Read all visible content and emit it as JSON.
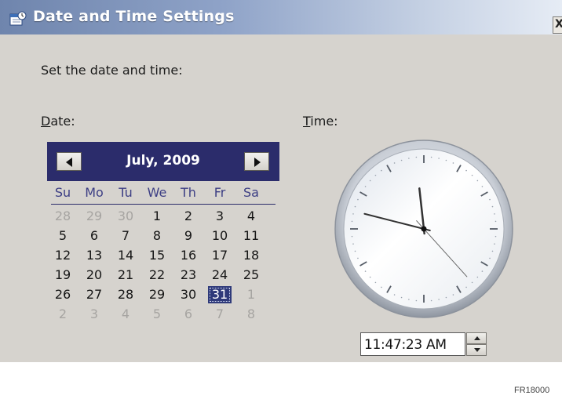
{
  "window": {
    "title": "Date and Time Settings",
    "title_icon": "calendar-clock-icon",
    "close_label": "X",
    "colors": {
      "titlebar_start": "#6f85ad",
      "titlebar_end": "#e6ecf5",
      "body": "#d6d3ce"
    }
  },
  "instruction": "Set the date and time:",
  "date_label": "Date:",
  "time_label": "Time:",
  "calendar": {
    "month_title": "July, 2009",
    "prev_icon": "left-arrow-icon",
    "next_icon": "right-arrow-icon",
    "header_color": "#2b2c6b",
    "days_of_week": [
      "Su",
      "Mo",
      "Tu",
      "We",
      "Th",
      "Fr",
      "Sa"
    ],
    "weeks": [
      [
        {
          "d": "28",
          "o": true
        },
        {
          "d": "29",
          "o": true
        },
        {
          "d": "30",
          "o": true
        },
        {
          "d": "1"
        },
        {
          "d": "2"
        },
        {
          "d": "3"
        },
        {
          "d": "4"
        }
      ],
      [
        {
          "d": "5"
        },
        {
          "d": "6"
        },
        {
          "d": "7"
        },
        {
          "d": "8"
        },
        {
          "d": "9"
        },
        {
          "d": "10"
        },
        {
          "d": "11"
        }
      ],
      [
        {
          "d": "12"
        },
        {
          "d": "13"
        },
        {
          "d": "14"
        },
        {
          "d": "15"
        },
        {
          "d": "16"
        },
        {
          "d": "17"
        },
        {
          "d": "18"
        }
      ],
      [
        {
          "d": "19"
        },
        {
          "d": "20"
        },
        {
          "d": "21"
        },
        {
          "d": "22"
        },
        {
          "d": "23"
        },
        {
          "d": "24"
        },
        {
          "d": "25"
        }
      ],
      [
        {
          "d": "26"
        },
        {
          "d": "27"
        },
        {
          "d": "28"
        },
        {
          "d": "29"
        },
        {
          "d": "30"
        },
        {
          "d": "31",
          "sel": true
        },
        {
          "d": "1",
          "o": true
        }
      ],
      [
        {
          "d": "2",
          "o": true
        },
        {
          "d": "3",
          "o": true
        },
        {
          "d": "4",
          "o": true
        },
        {
          "d": "5",
          "o": true
        },
        {
          "d": "6",
          "o": true
        },
        {
          "d": "7",
          "o": true
        },
        {
          "d": "8",
          "o": true
        }
      ]
    ],
    "selected_date": "31"
  },
  "clock": {
    "hours": 11,
    "minutes": 47,
    "seconds": 23
  },
  "time_field": {
    "value": "11:47:23 AM",
    "spin_up_icon": "spin-up-icon",
    "spin_down_icon": "spin-down-icon"
  },
  "figure_code": "FR18000"
}
